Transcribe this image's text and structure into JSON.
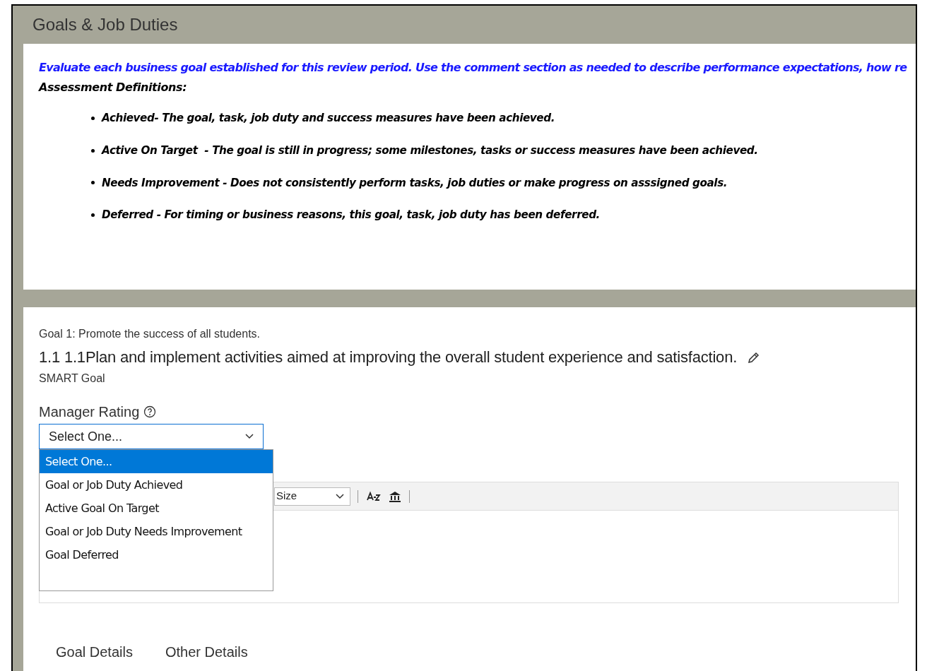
{
  "section": {
    "title": "Goals & Job Duties"
  },
  "intro": {
    "instruction": "Evaluate each business goal established for this review period. Use the comment section as needed to describe performance expectations, how re",
    "definitions_heading": "Assessment Definitions:",
    "definitions": [
      {
        "text": "Achieved- The goal, task, job duty and success measures have been achieved."
      },
      {
        "text": "Active On Target  - The goal is still in progress; some milestones, tasks or success measures have been achieved."
      },
      {
        "text": "Needs Improvement - Does not consistently perform tasks, job duties or make progress on asssigned goals."
      },
      {
        "text": "Deferred - For timing or business reasons, this goal, task, job duty has been deferred."
      }
    ]
  },
  "goal": {
    "category": "Goal 1: Promote the success of all students.",
    "title": "1.1 1.1Plan and implement activities aimed at improving the overall student experience and satisfaction.",
    "type": "SMART Goal",
    "rating_label": "Manager Rating",
    "rating_value": "Select One...",
    "rating_options": [
      {
        "label": "Select One...",
        "selected": true
      },
      {
        "label": "Goal or Job Duty Achieved",
        "selected": false
      },
      {
        "label": "Active Goal On Target",
        "selected": false
      },
      {
        "label": "Goal or Job Duty Needs Improvement",
        "selected": false
      },
      {
        "label": "Goal Deferred",
        "selected": false
      }
    ],
    "editor": {
      "size_select": "Size"
    },
    "tabs": [
      {
        "label": "Goal Details"
      },
      {
        "label": "Other Details"
      }
    ]
  }
}
